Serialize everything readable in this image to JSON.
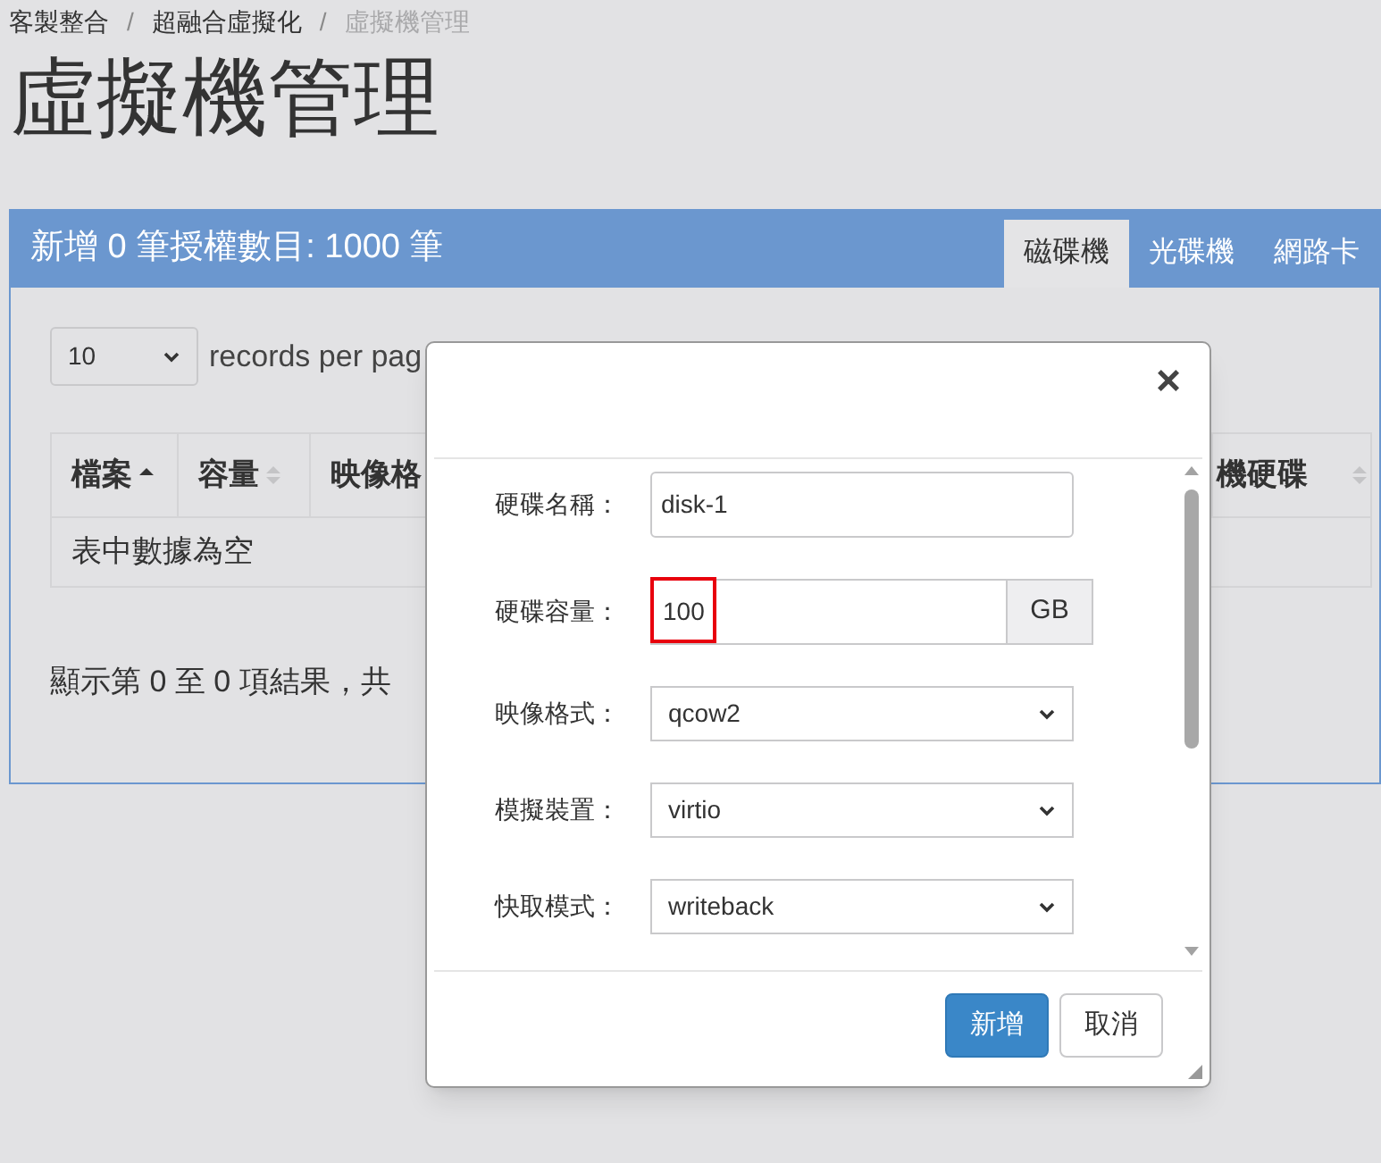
{
  "breadcrumb_separator": "/",
  "breadcrumb": [
    {
      "label": "客製整合",
      "current": false
    },
    {
      "label": "超融合虛擬化",
      "current": false
    },
    {
      "label": "虛擬機管理",
      "current": true
    }
  ],
  "page_title": "虛擬機管理",
  "panel": {
    "title": "新增 0 筆授權數目: 1000 筆",
    "tabs": [
      {
        "label": "磁碟機",
        "selected": true
      },
      {
        "label": "光碟機",
        "selected": false
      },
      {
        "label": "網路卡",
        "selected": false
      }
    ],
    "page_size": "10",
    "page_size_label": "records per pag",
    "table": {
      "columns": [
        {
          "label": "檔案",
          "sorted": true
        },
        {
          "label": "容量",
          "sorted": false
        },
        {
          "label": "映像格"
        },
        {
          "label": "機硬碟",
          "sorted": false
        }
      ],
      "empty_text": "表中數據為空"
    },
    "info": "顯示第 0 至 0 項結果，共"
  },
  "dialog": {
    "close": "×",
    "fields": [
      {
        "kind": "text",
        "label": "硬碟名稱：",
        "value": "disk-1"
      },
      {
        "kind": "addon",
        "label": "硬碟容量：",
        "value": "100",
        "addon": "GB",
        "highlighted": true
      },
      {
        "kind": "select",
        "label": "映像格式：",
        "value": "qcow2"
      },
      {
        "kind": "select",
        "label": "模擬裝置：",
        "value": "virtio"
      },
      {
        "kind": "select",
        "label": "快取模式：",
        "value": "writeback"
      }
    ],
    "buttons": [
      {
        "label": "新增",
        "primary": true
      },
      {
        "label": "取消",
        "primary": false
      }
    ]
  }
}
